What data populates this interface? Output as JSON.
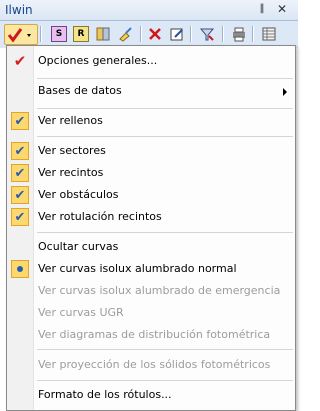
{
  "panel": {
    "title": "Ilwin",
    "pin_glyph": "‖",
    "close_glyph": "✕"
  },
  "toolbar": {
    "buttons": [
      {
        "name": "view-options-dropdown",
        "icon": "red-check-icon"
      },
      {
        "name": "s-button",
        "letter": "S"
      },
      {
        "name": "r-button",
        "letter": "R"
      },
      {
        "name": "layers-button",
        "icon": "layers-icon"
      },
      {
        "name": "brush-button",
        "icon": "brush-icon"
      },
      {
        "name": "delete-button",
        "icon": "red-x-icon"
      },
      {
        "name": "edit-button",
        "icon": "edit-icon"
      },
      {
        "name": "filter-button",
        "icon": "filter-icon"
      },
      {
        "name": "print-button",
        "icon": "print-icon"
      },
      {
        "name": "table-button",
        "icon": "table-icon"
      }
    ]
  },
  "menu": {
    "items": [
      {
        "label": "Opciones generales...",
        "state": "redcheck",
        "enabled": true
      },
      {
        "label": "Bases de datos",
        "state": "none",
        "enabled": true,
        "submenu": true
      },
      {
        "label": "Ver rellenos",
        "state": "checked",
        "enabled": true
      },
      {
        "label": "Ver sectores",
        "state": "checked",
        "enabled": true
      },
      {
        "label": "Ver recintos",
        "state": "checked",
        "enabled": true
      },
      {
        "label": "Ver obstáculos",
        "state": "checked",
        "enabled": true
      },
      {
        "label": "Ver rotulación recintos",
        "state": "checked",
        "enabled": true
      },
      {
        "label": "Ocultar curvas",
        "state": "none",
        "enabled": true
      },
      {
        "label": "Ver curvas isolux alumbrado normal",
        "state": "bullet",
        "enabled": true
      },
      {
        "label": "Ver curvas isolux alumbrado de emergencia",
        "state": "none",
        "enabled": false
      },
      {
        "label": "Ver curvas UGR",
        "state": "none",
        "enabled": false
      },
      {
        "label": "Ver diagramas de distribución fotométrica",
        "state": "none",
        "enabled": false
      },
      {
        "label": "Ver proyección de los sólidos fotométricos",
        "state": "none",
        "enabled": false
      },
      {
        "label": "Formato de los rótulos...",
        "state": "none",
        "enabled": true
      }
    ],
    "check_glyph": "✔"
  }
}
